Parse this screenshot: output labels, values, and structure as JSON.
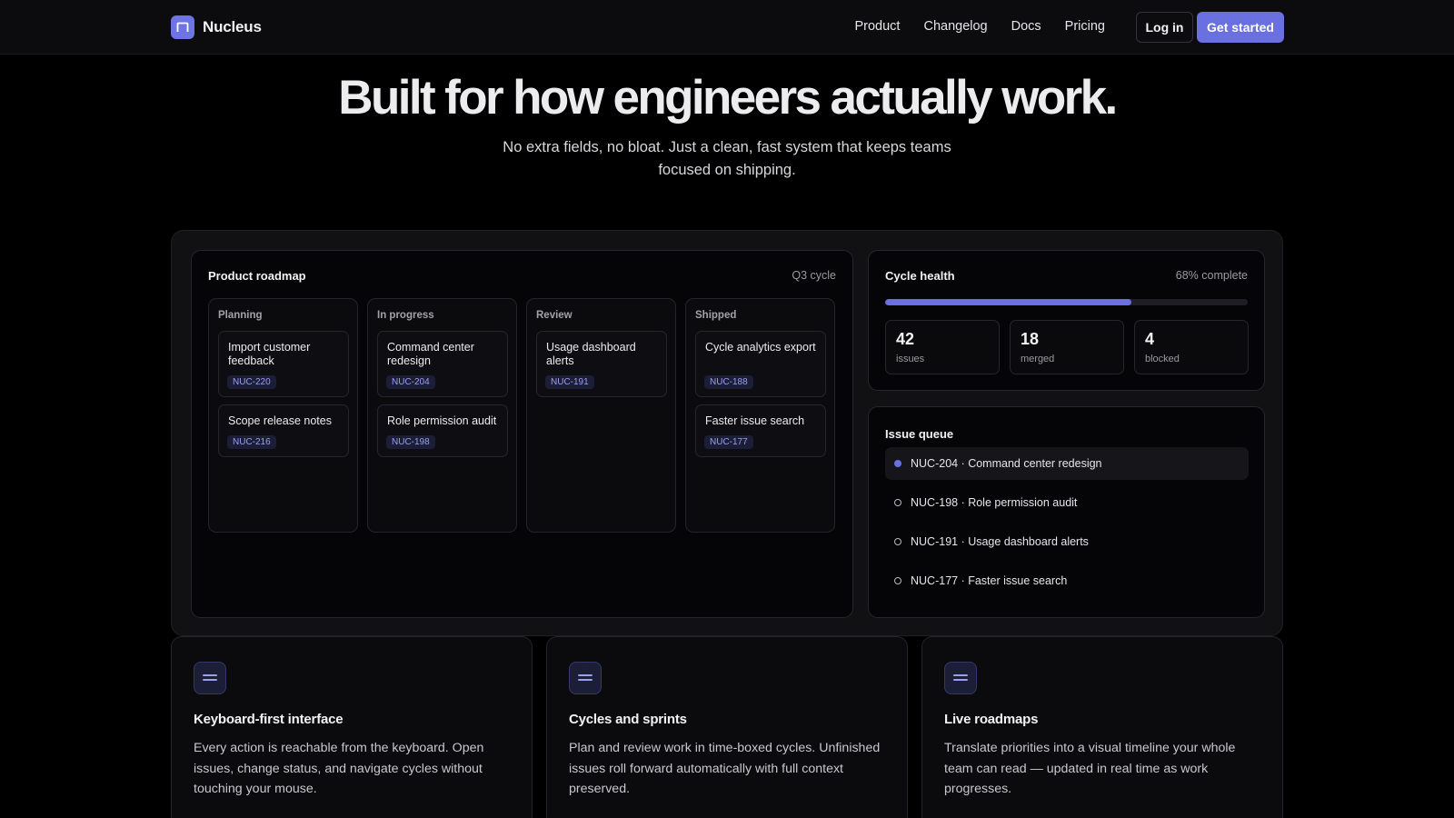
{
  "brand": {
    "name": "Nucleus",
    "accent": "#6a70e0"
  },
  "nav": {
    "links": [
      "Product",
      "Changelog",
      "Docs",
      "Pricing"
    ],
    "login_label": "Log in",
    "cta_label": "Get started"
  },
  "hero": {
    "title": "Built for how engineers actually work.",
    "subtitle": "No extra fields, no bloat. Just a clean, fast system that keeps teams focused on shipping."
  },
  "roadmap": {
    "title": "Product roadmap",
    "meta": "Q3 cycle",
    "columns": [
      {
        "title": "Planning",
        "cards": [
          {
            "title": "Import customer feedback",
            "tag": "NUC-220"
          },
          {
            "title": "Scope release notes",
            "tag": "NUC-216"
          }
        ]
      },
      {
        "title": "In progress",
        "cards": [
          {
            "title": "Command center redesign",
            "tag": "NUC-204"
          },
          {
            "title": "Role permission audit",
            "tag": "NUC-198"
          }
        ]
      },
      {
        "title": "Review",
        "cards": [
          {
            "title": "Usage dashboard alerts",
            "tag": "NUC-191"
          }
        ]
      },
      {
        "title": "Shipped",
        "cards": [
          {
            "title": "Cycle analytics export",
            "tag": "NUC-188"
          },
          {
            "title": "Faster issue search",
            "tag": "NUC-177"
          }
        ]
      }
    ]
  },
  "health": {
    "title": "Cycle health",
    "meta": "68% complete",
    "progress": 0.68,
    "stats": [
      {
        "value": "42",
        "label": "issues"
      },
      {
        "value": "18",
        "label": "merged"
      },
      {
        "value": "4",
        "label": "blocked"
      }
    ]
  },
  "queue": {
    "title": "Issue queue",
    "items": [
      {
        "text": "NUC-204 · Command center redesign",
        "active": true
      },
      {
        "text": "NUC-198 · Role permission audit",
        "active": false
      },
      {
        "text": "NUC-191 · Usage dashboard alerts",
        "active": false
      },
      {
        "text": "NUC-177 · Faster issue search",
        "active": false
      }
    ]
  },
  "features": [
    {
      "icon": "menu-lines-icon",
      "title": "Keyboard-first interface",
      "body": "Every action is reachable from the keyboard. Open issues, change status, and navigate cycles without touching your mouse."
    },
    {
      "icon": "menu-lines-icon",
      "title": "Cycles and sprints",
      "body": "Plan and review work in time-boxed cycles. Unfinished issues roll forward automatically with full context preserved."
    },
    {
      "icon": "menu-lines-icon",
      "title": "Live roadmaps",
      "body": "Translate priorities into a visual timeline your whole team can read — updated in real time as work progresses."
    }
  ]
}
